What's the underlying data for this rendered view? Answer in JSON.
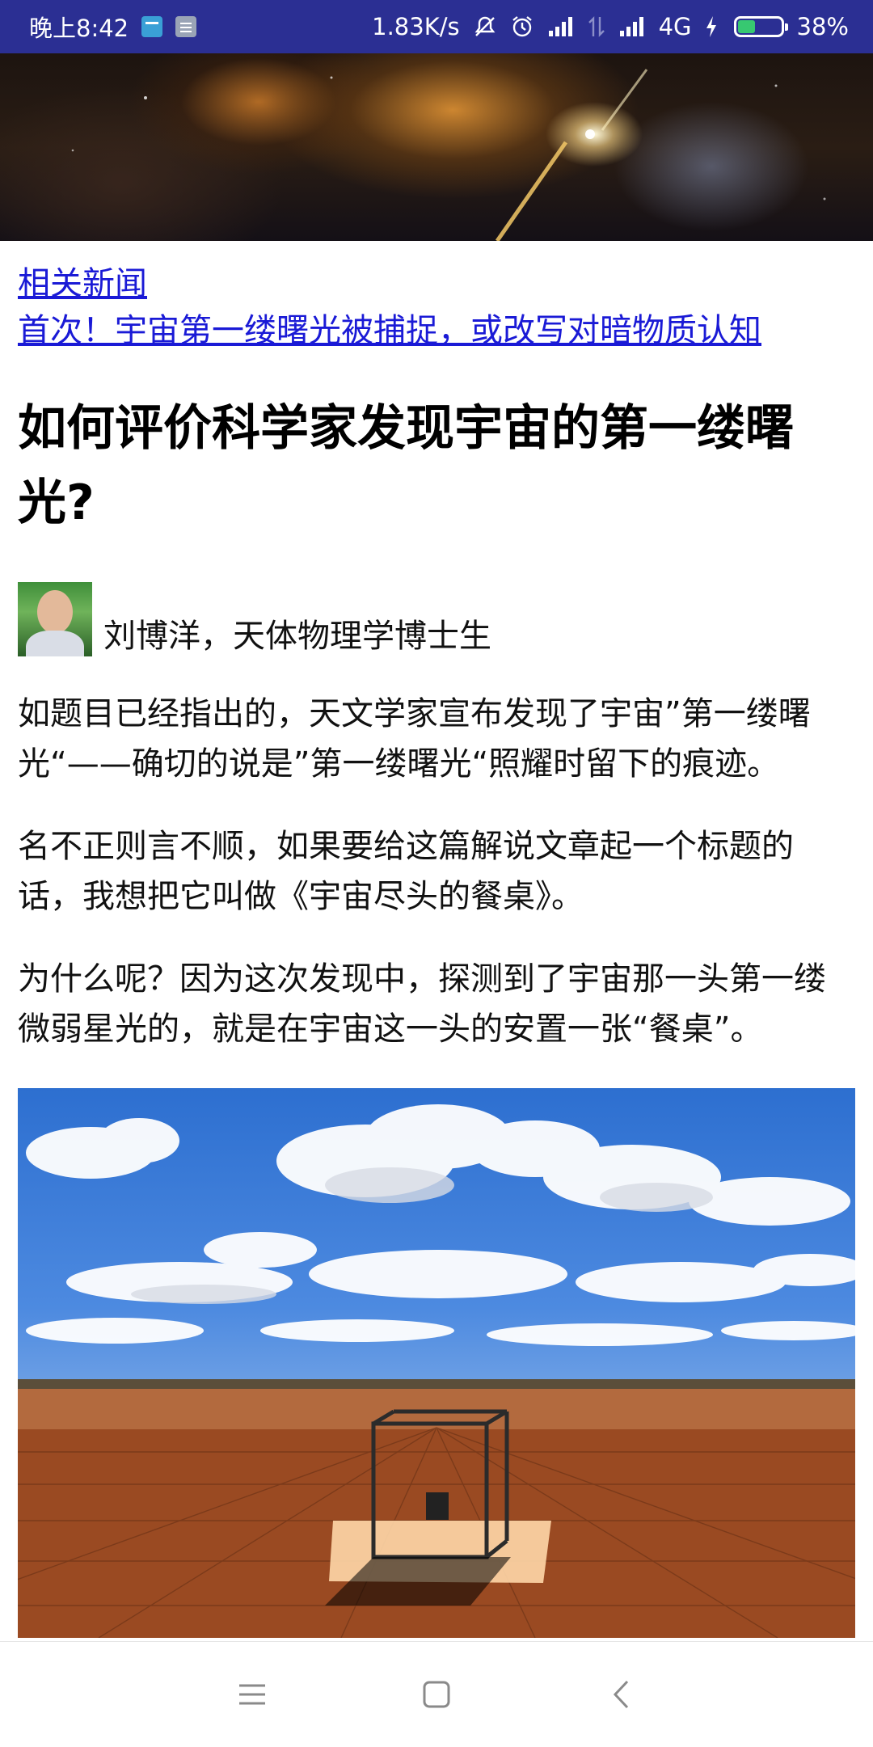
{
  "status_bar": {
    "time": "晚上8:42",
    "net_speed": "1.83K/s",
    "network_type": "4G",
    "battery_percent": "38%",
    "battery_level": 0.38,
    "notification_icons": [
      "calendar-icon",
      "note-icon"
    ],
    "status_icons": [
      "mute-icon",
      "alarm-icon",
      "signal-icon",
      "data-transfer-icon",
      "signal-icon",
      "charging-icon",
      "battery-icon"
    ]
  },
  "related_news": {
    "label": "相关新闻",
    "headline": "首次！宇宙第一缕曙光被捕捉，或改写对暗物质认知"
  },
  "article": {
    "title": "如何评价科学家发现宇宙的第一缕曙光?",
    "author": "刘博洋，天体物理学博士生",
    "paragraphs": [
      "如题目已经指出的，天文学家宣布发现了宇宙”第一缕曙光“——确切的说是”第一缕曙光“照耀时留下的痕迹。",
      "名不正则言不顺，如果要给这篇解说文章起一个标题的话，我想把它叫做《宇宙尽头的餐桌》。",
      "为什么呢？因为这次发现中，探测到了宇宙那一头第一缕微弱星光的，就是在宇宙这一头的安置一张“餐桌”。"
    ]
  },
  "colors": {
    "status_bar_bg": "#2b2f93",
    "link": "#1a1ad6",
    "battery_fill": "#37c871"
  },
  "nav_bar": {
    "buttons": [
      "menu-icon",
      "home-icon",
      "back-icon"
    ]
  }
}
